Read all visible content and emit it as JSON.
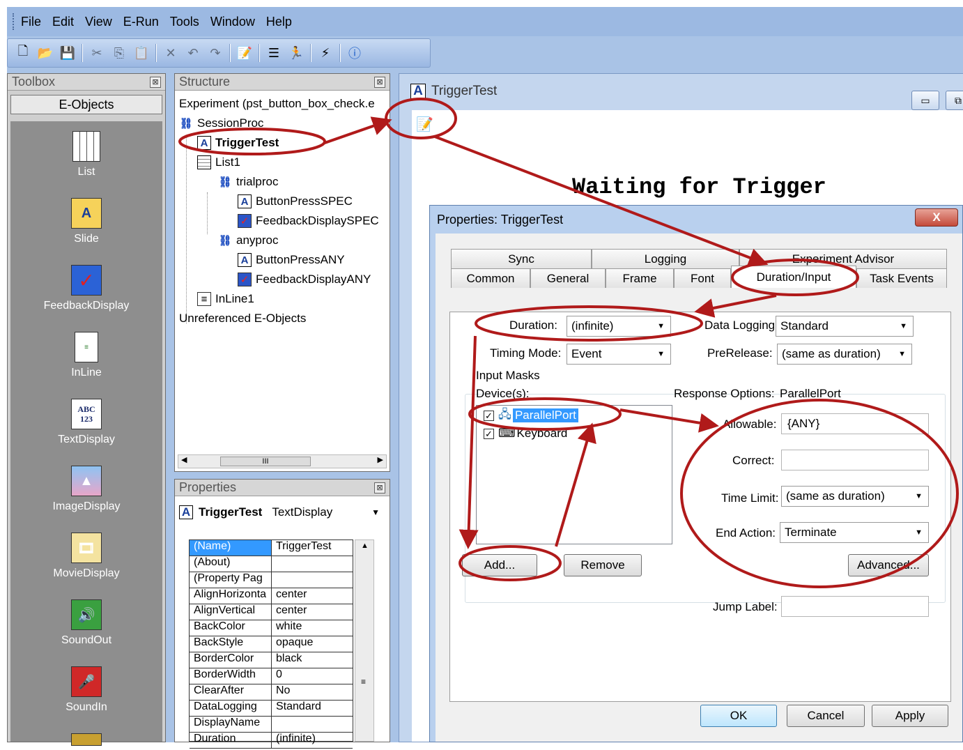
{
  "menu": [
    "File",
    "Edit",
    "View",
    "E-Run",
    "Tools",
    "Window",
    "Help"
  ],
  "toolbox": {
    "title": "Toolbox",
    "tab": "E-Objects",
    "items": [
      {
        "label": "List",
        "icon": "list-icon"
      },
      {
        "label": "Slide",
        "icon": "slide-icon"
      },
      {
        "label": "FeedbackDisplay",
        "icon": "feedback-icon"
      },
      {
        "label": "InLine",
        "icon": "inline-icon"
      },
      {
        "label": "TextDisplay",
        "icon": "textdisplay-icon",
        "glyph": "ABC 123"
      },
      {
        "label": "ImageDisplay",
        "icon": "image-icon"
      },
      {
        "label": "MovieDisplay",
        "icon": "movie-icon"
      },
      {
        "label": "SoundOut",
        "icon": "speaker-icon"
      },
      {
        "label": "SoundIn",
        "icon": "microphone-icon"
      }
    ]
  },
  "structure": {
    "title": "Structure",
    "nodes": [
      {
        "label": "Experiment (pst_button_box_check.e"
      },
      {
        "label": "SessionProc"
      },
      {
        "label": "TriggerTest"
      },
      {
        "label": "List1"
      },
      {
        "label": "trialproc"
      },
      {
        "label": "ButtonPressSPEC"
      },
      {
        "label": "FeedbackDisplaySPEC"
      },
      {
        "label": "anyproc"
      },
      {
        "label": "ButtonPressANY"
      },
      {
        "label": "FeedbackDisplayANY"
      },
      {
        "label": "InLine1"
      },
      {
        "label": "Unreferenced E-Objects"
      }
    ],
    "scroll_glyph": "III"
  },
  "properties": {
    "title": "Properties",
    "object_name": "TriggerTest",
    "object_type": "TextDisplay",
    "rows": [
      {
        "k": "(Name)",
        "v": "TriggerTest"
      },
      {
        "k": "(About)",
        "v": ""
      },
      {
        "k": "(Property Pag",
        "v": ""
      },
      {
        "k": "AlignHorizonta",
        "v": "center"
      },
      {
        "k": "AlignVertical",
        "v": "center"
      },
      {
        "k": "BackColor",
        "v": "white"
      },
      {
        "k": "BackStyle",
        "v": "opaque"
      },
      {
        "k": "BorderColor",
        "v": "black"
      },
      {
        "k": "BorderWidth",
        "v": "0"
      },
      {
        "k": "ClearAfter",
        "v": "No"
      },
      {
        "k": "DataLogging",
        "v": "Standard"
      },
      {
        "k": "DisplayName",
        "v": ""
      },
      {
        "k": "Duration",
        "v": "(infinite)"
      }
    ]
  },
  "trigger_window": {
    "title": "TriggerTest",
    "canvas_text": "Waiting for Trigger"
  },
  "dialog": {
    "title": "Properties: TriggerTest",
    "close": "X",
    "tabs_back": [
      "Sync",
      "Logging",
      "Experiment Advisor"
    ],
    "tabs_front": [
      "Common",
      "General",
      "Frame",
      "Font",
      "Duration/Input",
      "Task Events"
    ],
    "active_tab": "Duration/Input",
    "duration_label": "Duration:",
    "duration_value": "(infinite)",
    "data_logging_label": "Data Logging:",
    "data_logging_value": "Standard",
    "timing_mode_label": "Timing Mode:",
    "timing_mode_value": "Event",
    "prerelease_label": "PreRelease:",
    "prerelease_value": "(same as duration)",
    "input_masks_label": "Input Masks",
    "devices_label": "Device(s):",
    "response_options_label": "Response Options:",
    "response_options_device": "ParallelPort",
    "devices": [
      {
        "label": "ParallelPort",
        "checked": true,
        "selected": true
      },
      {
        "label": "Keyboard",
        "checked": true,
        "selected": false
      }
    ],
    "allowable_label": "Allowable:",
    "allowable_value": "{ANY}",
    "correct_label": "Correct:",
    "correct_value": "",
    "time_limit_label": "Time Limit:",
    "time_limit_value": "(same as duration)",
    "end_action_label": "End Action:",
    "end_action_value": "Terminate",
    "add_button": "Add...",
    "remove_button": "Remove",
    "advanced_button": "Advanced...",
    "jump_label_label": "Jump Label:",
    "jump_label_value": "",
    "ok_button": "OK",
    "cancel_button": "Cancel",
    "apply_button": "Apply"
  },
  "colors": {
    "annotation": "#b01a1a",
    "selection": "#3399ff",
    "app_background": "#a9c3e6"
  }
}
